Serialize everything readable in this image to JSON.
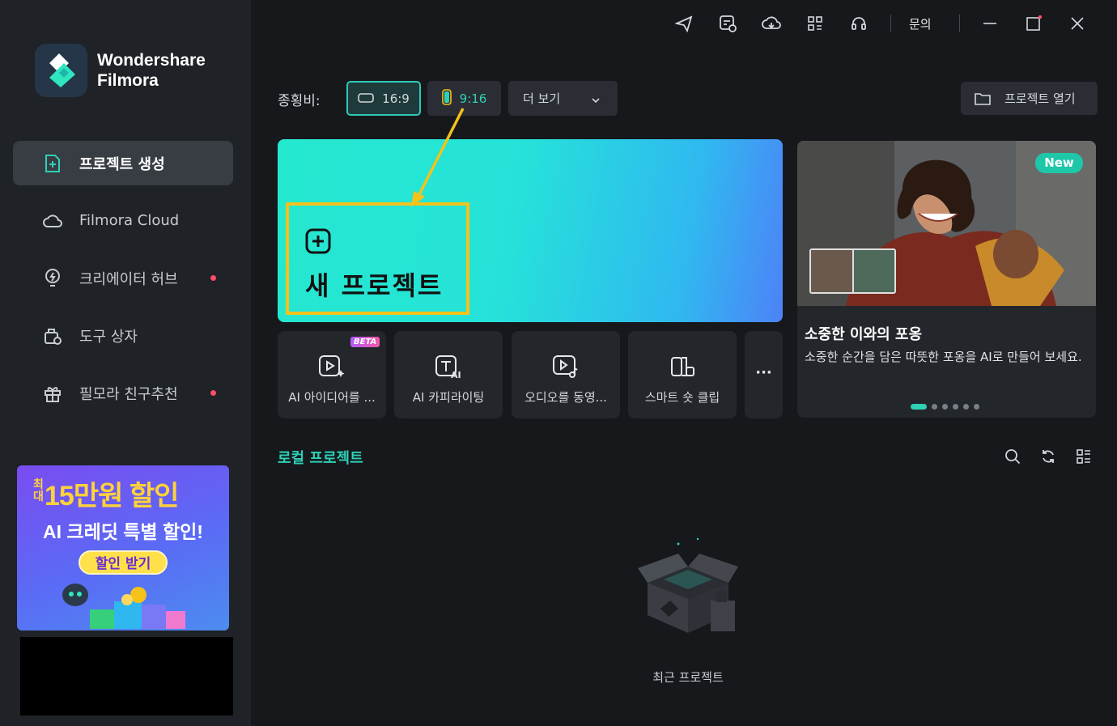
{
  "app": {
    "brand_line1": "Wondershare",
    "brand_line2": "Filmora"
  },
  "sidebar": {
    "items": [
      {
        "label": "프로젝트 생성",
        "icon": "new-project-icon"
      },
      {
        "label": "Filmora Cloud",
        "icon": "cloud-icon"
      },
      {
        "label": "크리에이터 허브",
        "icon": "bulb-icon"
      },
      {
        "label": "도구 상자",
        "icon": "toolbox-icon"
      },
      {
        "label": "필모라 친구추천",
        "icon": "gift-icon"
      }
    ],
    "promo": {
      "small": "최대",
      "headline": "15만원 할인",
      "line2": "AI 크레딧 특별 할인!",
      "button": "할인 받기"
    }
  },
  "topbar": {
    "contact_label": "문의"
  },
  "ratio": {
    "label": "종횡비:",
    "options": [
      "16:9",
      "9:16"
    ],
    "selected": "16:9",
    "more_label": "더 보기"
  },
  "open_project_label": "프로젝트 열기",
  "hero": {
    "title": "새 프로젝트"
  },
  "tools": [
    {
      "label": "AI 아이디어를 ...",
      "badge": "BETA"
    },
    {
      "label": "AI 카피라이팅"
    },
    {
      "label": "오디오를 동영..."
    },
    {
      "label": "스마트 숏 클립"
    }
  ],
  "more_tools_label": "···",
  "feature": {
    "badge": "New",
    "title": "소중한 이와의 포옹",
    "description": "소중한 순간을 담은 따뜻한 포옹을 AI로 만들어 보세요.",
    "slide_count": 6,
    "active_slide": 1
  },
  "local": {
    "title": "로컬 프로젝트",
    "empty_text": "최근 프로젝트"
  },
  "colors": {
    "accent": "#2ed1b6",
    "highlight": "#f5c21a",
    "sidebar_bg": "#1f2226",
    "main_bg": "#16181c"
  }
}
